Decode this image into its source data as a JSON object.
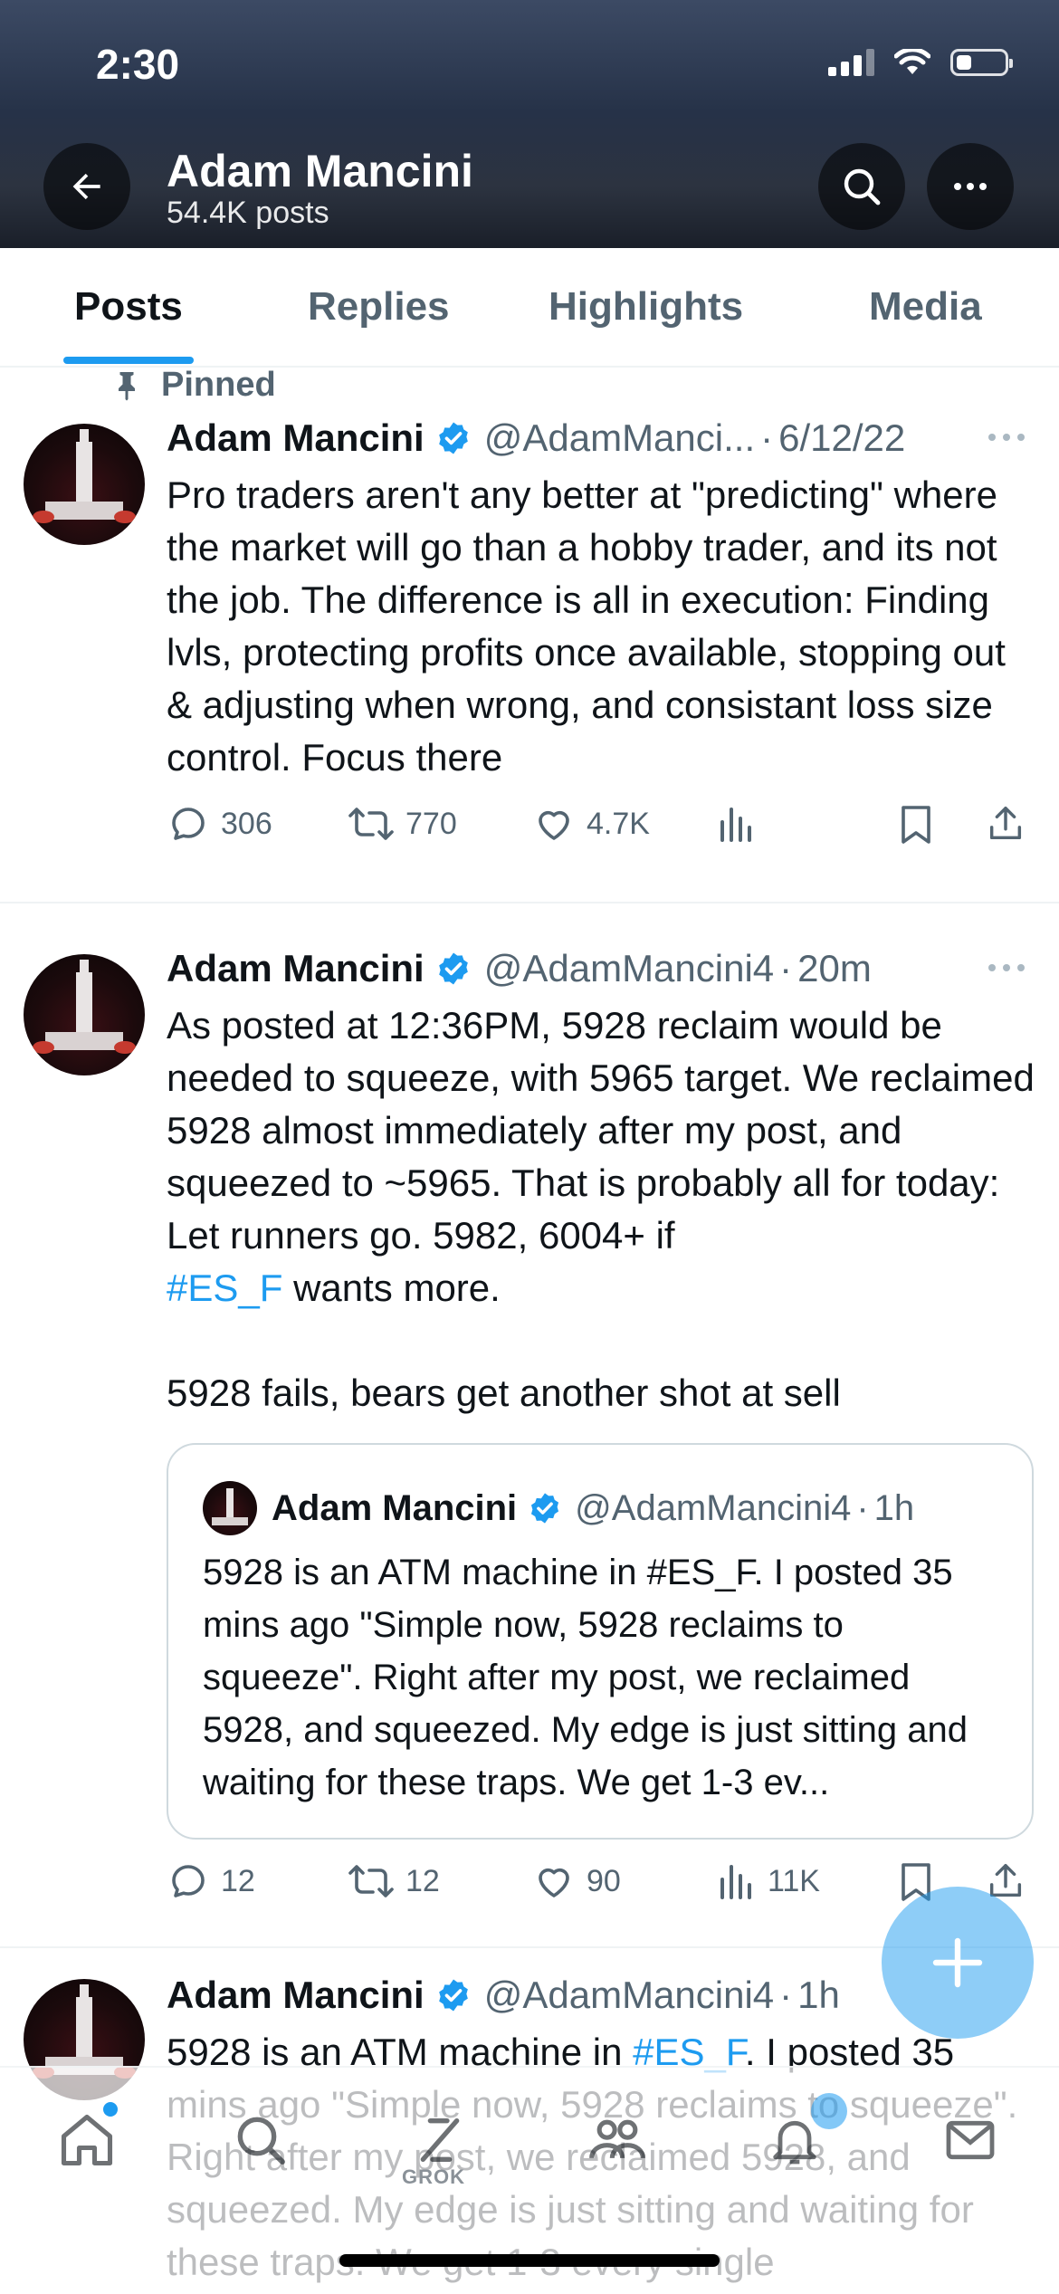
{
  "status_bar": {
    "time": "2:30"
  },
  "header": {
    "name": "Adam Mancini",
    "posts_count": "54.4K posts"
  },
  "tabs": [
    {
      "label": "Posts",
      "active": true
    },
    {
      "label": "Replies",
      "active": false
    },
    {
      "label": "Highlights",
      "active": false
    },
    {
      "label": "Media",
      "active": false
    }
  ],
  "pinned_label": "Pinned",
  "posts": [
    {
      "name": "Adam Mancini",
      "handle": "@AdamManci...",
      "separator": "·",
      "time": "6/12/22",
      "text": "Pro traders aren't any better at \"predicting\" where the market will go than a hobby trader, and its not the job. The difference is all in execution: Finding lvls, protecting profits once available, stopping out & adjusting when wrong, and consistant loss size control. Focus there",
      "replies": "306",
      "reposts": "770",
      "likes": "4.7K",
      "views": ""
    },
    {
      "name": "Adam Mancini",
      "handle": "@AdamMancini4",
      "separator": "·",
      "time": "20m",
      "text_parts": {
        "p1": "As posted at 12:36PM, 5928 reclaim would be needed to squeeze, with 5965 target. We reclaimed 5928 almost immediately after my post, and squeezed to ~5965. That is probably all for today: Let runners go. 5982, 6004+ if",
        "hashtag": "#ES_F",
        "p2": " wants more.",
        "p3": "5928 fails, bears get another shot at sell"
      },
      "quote": {
        "name": "Adam Mancini",
        "handle": "@AdamMancini4",
        "separator": "·",
        "time": "1h",
        "text": "5928 is an ATM machine in #ES_F. I posted 35 mins ago \"Simple now, 5928 reclaims to squeeze\". Right after my post, we reclaimed 5928, and squeezed. My edge is just sitting and waiting for these traps. We get 1-3 ev..."
      },
      "replies": "12",
      "reposts": "12",
      "likes": "90",
      "views": "11K"
    },
    {
      "name": "Adam Mancini",
      "handle": "@AdamMancini4",
      "separator": "·",
      "time": "1h",
      "text_parts": {
        "p1": "5928 is an ATM machine in ",
        "hashtag": "#ES_F",
        "p2": ". I posted 35 mins ago \"Simple now, 5928 reclaims to squeeze\". Right after my post, we reclaimed 5928, and squeezed. My edge is just sitting and waiting for these traps. We get 1-3 every single"
      }
    }
  ],
  "bottom_nav": {
    "items": [
      "home-icon",
      "search-icon",
      "grok-icon",
      "communities-icon",
      "notifications-icon",
      "messages-icon"
    ],
    "grok_label": "GROK"
  },
  "colors": {
    "accent": "#1d9bf0",
    "text": "#0f1419",
    "muted": "#536471"
  }
}
